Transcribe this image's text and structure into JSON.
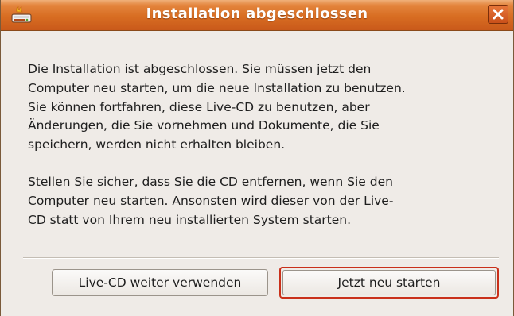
{
  "window": {
    "title": "Installation abgeschlossen",
    "app_icon": "installer-drive-icon",
    "close_icon": "close-icon"
  },
  "message": {
    "paragraph1_lines": [
      "Die Installation ist abgeschlossen. Sie müssen jetzt den",
      "Computer neu starten, um die neue Installation zu benutzen.",
      "Sie können fortfahren, diese Live-CD zu benutzen, aber",
      "Änderungen, die Sie vornehmen und Dokumente, die Sie",
      "speichern, werden nicht erhalten bleiben."
    ],
    "paragraph2_lines": [
      "Stellen Sie sicher, dass Sie die CD entfernen, wenn Sie den",
      "Computer neu starten. Ansonsten wird dieser von der Live-",
      "CD statt von Ihrem neu installierten System starten."
    ]
  },
  "buttons": {
    "continue_label": "Live-CD weiter verwenden",
    "restart_label": "Jetzt neu starten"
  },
  "colors": {
    "titlebar": "#d86d22",
    "dialog_background": "#efebe7",
    "default_button_focus": "#c9301a"
  }
}
